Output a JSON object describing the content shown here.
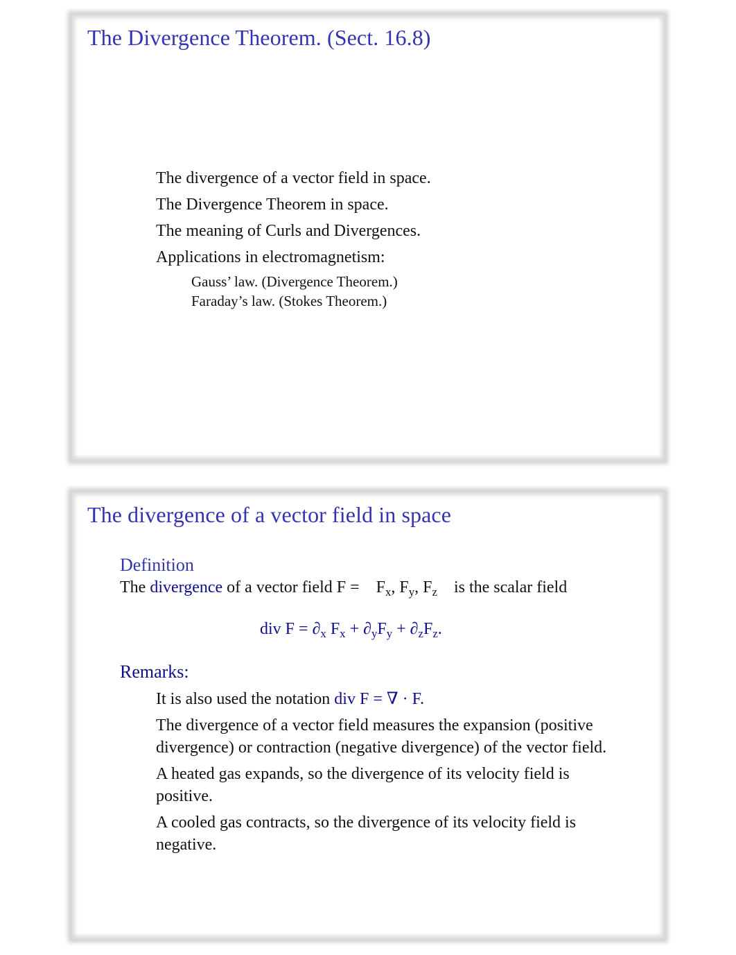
{
  "slides": [
    {
      "title": "The Divergence Theorem. (Sect. 16.8)",
      "outline": [
        "The divergence of a vector field in space.",
        "The Divergence Theorem in space.",
        "The meaning of Curls and Divergences.",
        "Applications in electromagnetism:"
      ],
      "sub_outline": [
        "Gauss’ law. (Divergence Theorem.)",
        "Faraday’s law. (Stokes Theorem.)"
      ]
    },
    {
      "title": "The divergence of a vector field in space",
      "definition": {
        "heading": "Definition",
        "text_before": "The ",
        "term": "divergence",
        "text_mid": " of a vector field F = ",
        "components": [
          "F",
          "x",
          ", F",
          "y",
          ", F",
          "z"
        ],
        "text_after": " is the scalar field"
      },
      "formula": {
        "lhs": "div F = ",
        "terms": [
          {
            "d": "∂",
            "ds": "x",
            "f": "F",
            "fs": "x"
          },
          {
            "d": "∂",
            "ds": "y",
            "f": "F",
            "fs": "y"
          },
          {
            "d": "∂",
            "ds": "z",
            "f": "F",
            "fs": "z"
          }
        ],
        "plus": " + ",
        "end": "."
      },
      "remarks": {
        "heading": "Remarks:",
        "notation_text": "It is also used the notation ",
        "notation_math": "div F = ∇ · F",
        "notation_end": ".",
        "items": [
          "The divergence of a vector field measures the expansion (positive divergence) or contraction (negative divergence) of the vector field.",
          "A heated gas expands, so the divergence of its velocity field is positive.",
          "A cooled gas contracts, so the divergence of its velocity field is negative."
        ]
      }
    }
  ],
  "colors": {
    "frame_title": "#3333b3",
    "highlight": "#0d0d8c",
    "frame_border": "#d0d0d0"
  }
}
